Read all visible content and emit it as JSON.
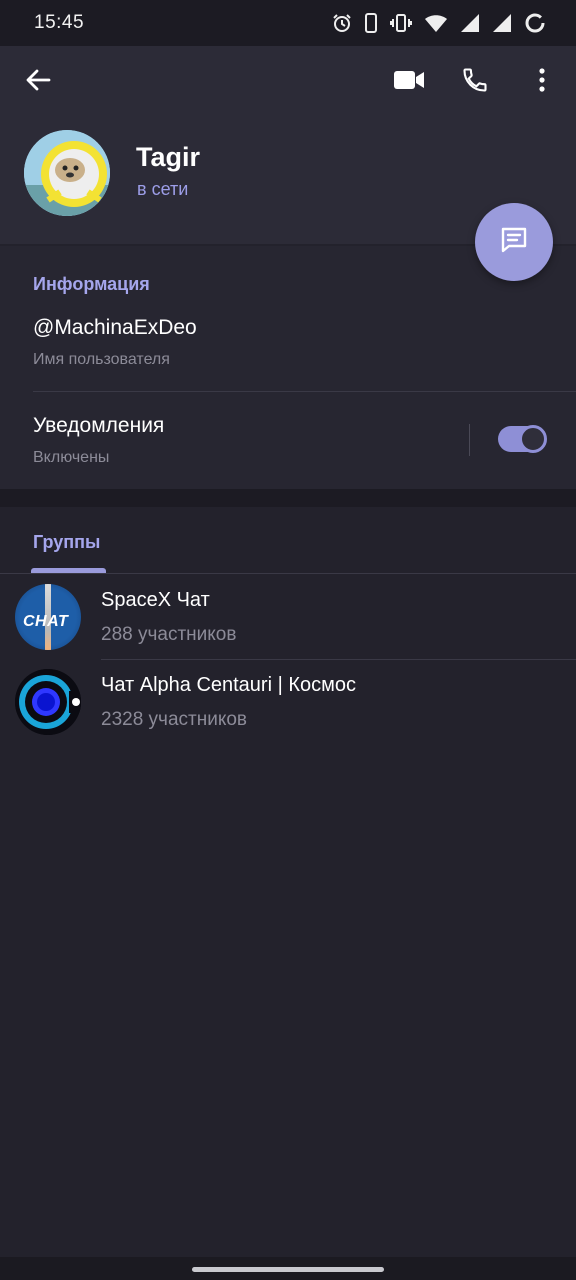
{
  "status_bar": {
    "time": "15:45",
    "icons": [
      "alarm-icon",
      "phone-outline-icon",
      "vibrate-icon",
      "wifi-icon",
      "signal-icon",
      "signal-icon",
      "battery-saver-icon"
    ]
  },
  "header": {
    "name": "Tagir",
    "status": "в сети",
    "background": "#2c2b37"
  },
  "info": {
    "section_title": "Информация",
    "username": "@MachinaExDeo",
    "username_caption": "Имя пользователя",
    "notifications_label": "Уведомления",
    "notifications_value": "Включены",
    "notifications_on": true
  },
  "groups": {
    "tab_label": "Группы",
    "items": [
      {
        "title": "SpaceX Чат",
        "subtitle": "288 участников",
        "avatar_text": "CHAT"
      },
      {
        "title": "Чат Alpha Centauri | Космос",
        "subtitle": "2328 участников"
      }
    ]
  },
  "colors": {
    "accent": "#9a9bdc",
    "accent_text": "#a5a6ec",
    "background": "#23222c",
    "secondary_text": "#8c8b98"
  }
}
